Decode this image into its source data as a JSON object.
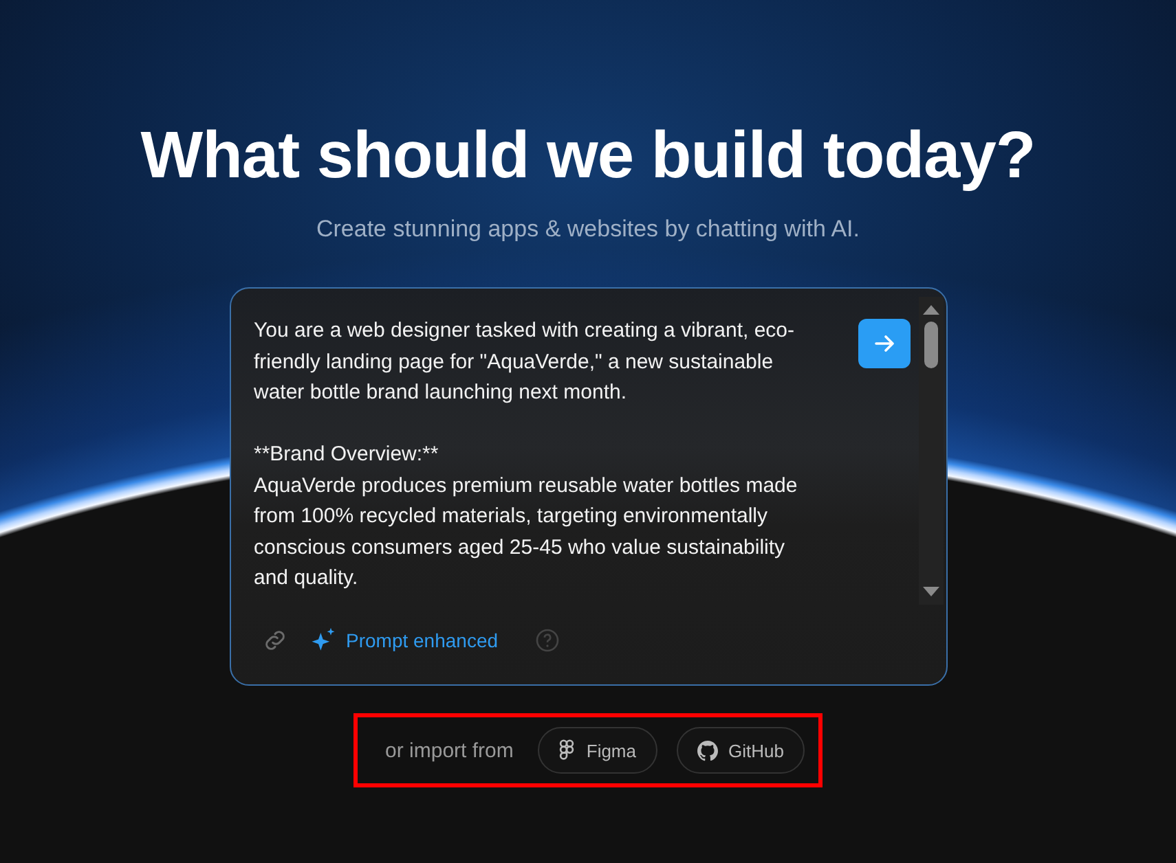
{
  "heading": "What should we build today?",
  "subheading": "Create stunning apps & websites by chatting with AI.",
  "prompt": {
    "paragraphs": [
      "You are a web designer tasked with creating a vibrant, eco-friendly landing page for \"AquaVerde,\" a new sustainable water bottle brand launching next month.",
      "**Brand Overview:**\nAquaVerde produces premium reusable water bottles made from 100% recycled materials, targeting environmentally conscious consumers aged 25-45 who value sustainability and quality."
    ],
    "enhanced": true,
    "enhanced_label": "Prompt enhanced"
  },
  "import": {
    "label": "or import from",
    "sources": [
      {
        "kind": "figma",
        "label": "Figma"
      },
      {
        "kind": "github",
        "label": "GitHub"
      }
    ]
  },
  "highlighted": true
}
